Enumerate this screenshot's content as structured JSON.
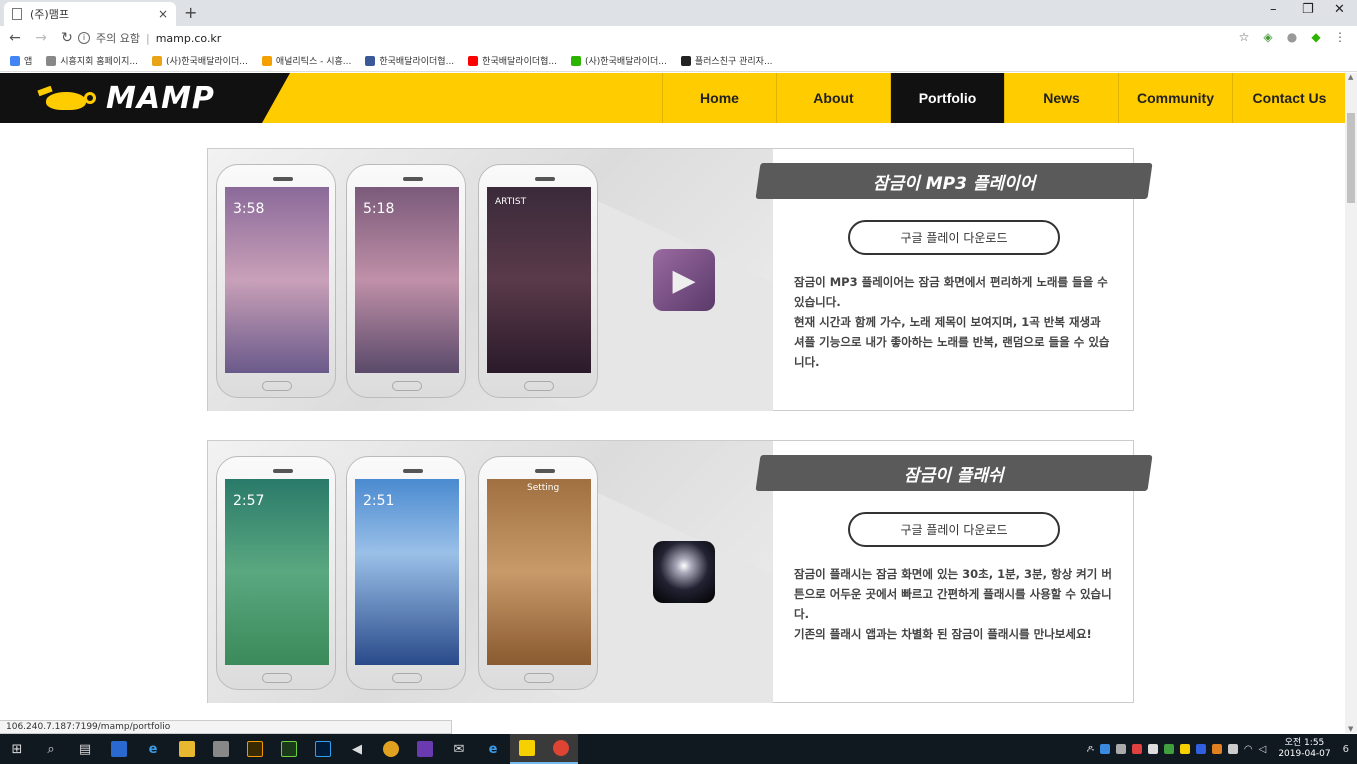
{
  "browser": {
    "tab_title": "(주)맴프",
    "tab_close": "×",
    "new_tab": "+",
    "win_min": "–",
    "win_max": "❐",
    "win_close": "✕",
    "security_label": "주의 요함",
    "separator": "|",
    "url": "mamp.co.kr",
    "bookmarks": [
      {
        "label": "앱",
        "color": "#4285f4"
      },
      {
        "label": "시흥지회 홈페이지...",
        "color": "#888888"
      },
      {
        "label": "(사)한국배달라이더...",
        "color": "#e8a317"
      },
      {
        "label": "애널리틱스 - 시흥...",
        "color": "#f4a000"
      },
      {
        "label": "한국배달라이더협...",
        "color": "#3b5998"
      },
      {
        "label": "한국배달라이더협...",
        "color": "#ff0000"
      },
      {
        "label": "(사)한국배달라이더...",
        "color": "#2db400"
      },
      {
        "label": "플러스친구 관리자...",
        "color": "#222222"
      }
    ],
    "status_url": "106.240.7.187:7199/mamp/portfolio"
  },
  "site": {
    "logo_text": "MAMP",
    "brand_color": "#ffcc00",
    "nav": [
      {
        "label": "Home",
        "active": false
      },
      {
        "label": "About",
        "active": false
      },
      {
        "label": "Portfolio",
        "active": true
      },
      {
        "label": "News",
        "active": false
      },
      {
        "label": "Community",
        "active": false
      },
      {
        "label": "Contact Us",
        "active": false
      }
    ]
  },
  "portfolio": [
    {
      "title": "잠금이 MP3 플레이어",
      "download_label": "구글 플레이 다운로드",
      "description": [
        "잠금이 MP3 플레이어는 잠금 화면에서 편리하게 노래를 들을 수 있습니다.",
        "현재 시간과 함께 가수, 노래 제목이 보여지며, 1곡 반복 재생과 셔플 기능으로 내가 좋아하는 노래를 반복, 랜덤으로 들을 수 있습니다."
      ],
      "screens": [
        "3:58",
        "5:18",
        "ARTIST"
      ]
    },
    {
      "title": "잠금이 플래쉬",
      "download_label": "구글 플레이 다운로드",
      "description": [
        "잠금이 플래시는 잠금 화면에 있는 30초, 1분, 3분, 항상 켜기 버튼으로 어두운 곳에서 빠르고 간편하게 플래시를 사용할 수 있습니다.",
        "기존의 플래시 앱과는 차별화 된 잠금이 플래시를 만나보세요!"
      ],
      "screens": [
        "2:57",
        "2:51",
        "Setting"
      ]
    }
  ],
  "taskbar": {
    "time": "오전 1:55",
    "date": "2019-04-07",
    "notifications": "6"
  }
}
